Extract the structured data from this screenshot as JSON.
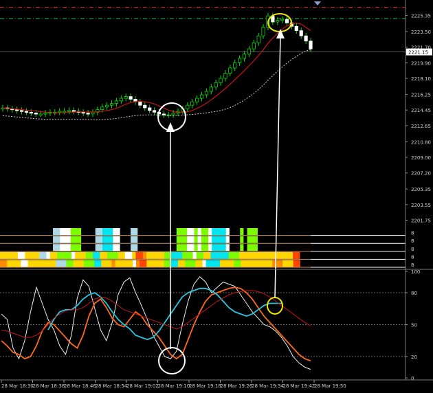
{
  "chart_data": [
    {
      "type": "candlestick",
      "title": "",
      "ylim": [
        2201.0,
        2226.5
      ],
      "y_ticks": [
        "2225.35",
        "2223.50",
        "2221.70",
        "2219.90",
        "2218.10",
        "2216.25",
        "2214.45",
        "2212.65",
        "2210.80",
        "2209.00",
        "2207.20",
        "2205.35",
        "2203.55",
        "2201.75"
      ],
      "current_price_label": "2221.15",
      "current_price": 2221.15,
      "reference_levels": [
        {
          "value": 2226.3,
          "style": "dash-dot",
          "color": "#e02020"
        },
        {
          "value": 2225.0,
          "style": "dash-dot",
          "color": "#1fbf3f"
        }
      ],
      "ma_fast_color": "#c81414",
      "ma_slow_color": "#cfcfcf",
      "candle_up_color": "#00e000",
      "candle_down_color": "#ffffff",
      "closes": [
        2214.7,
        2214.6,
        2214.5,
        2214.4,
        2214.3,
        2214.2,
        2214.1,
        2214.0,
        2214.0,
        2214.1,
        2214.2,
        2214.2,
        2214.3,
        2214.3,
        2214.4,
        2214.3,
        2214.2,
        2214.1,
        2214.0,
        2214.2,
        2214.5,
        2214.8,
        2215.0,
        2215.2,
        2215.5,
        2215.8,
        2216.0,
        2215.7,
        2215.4,
        2215.0,
        2214.7,
        2214.4,
        2214.2,
        2214.0,
        2213.9,
        2213.9,
        2214.1,
        2214.3,
        2214.6,
        2215.0,
        2215.4,
        2215.8,
        2216.2,
        2216.6,
        2217.1,
        2217.6,
        2218.1,
        2218.7,
        2219.3,
        2219.9,
        2220.4,
        2220.9,
        2221.5,
        2222.2,
        2223.0,
        2224.0,
        2225.3,
        2224.6,
        2224.8,
        2224.9,
        2224.5,
        2224.1,
        2223.6,
        2223.0,
        2222.4,
        2221.5
      ],
      "x_ticks": [
        "28 Mar 18:30",
        "28 Mar 18:38",
        "28 Mar 18:46",
        "28 Mar 18:54",
        "28 Mar 19:02",
        "28 Mar 19:10",
        "28 Mar 19:18",
        "28 Mar 19:26",
        "28 Mar 19:34",
        "28 Mar 19:42",
        "28 Mar 19:50"
      ]
    },
    {
      "type": "heatmap",
      "rows": 5,
      "row_labels": [
        "8",
        "8",
        "8",
        "8",
        "8"
      ],
      "colors": {
        "L": "#add8e6",
        "G": "#7cfc00",
        "C": "#00e5ee",
        "W": "#ffffff",
        "Y": "#ffd700",
        "O": "#ff8c00",
        "R": "#ff4500",
        "K": "#000000"
      },
      "cells": [
        "KKKKKKKKKKKKKKKLLWWWGGGKKKKLLCCCWWKKKLLKKKKKKKKKKKGGGWWGWGGWCCCCWKKKGKGGGKKKKKKKKKKKKKKK",
        "KKKKKKKKKKKKKKKLLWWWGGGKKKKLLCCCWWKKKLLKKKKKKKKKKKGGGWWGWGGWCCCCWKKKGKGGGKKKKKKKKKKKKKKK",
        "KKKKKKKKKKKKKKKLLWWWGGGKKKKLLCCCWWKKKLLKKKKKKKKKKKGGGWWGWGGWCCCCWKKKGKGGGKKKKKKKKKKKKKKK",
        "YYYYYWWYYYYLLWYYGGGGWYYYGGCCYYGGGYYWWYRROYYYYYGGCCCGGGWGGYYCCCCCGGGYYYYYYYYYYYYYYYRRKKK",
        "OOYYYYWWYYYYYYYYLLLGGYYYGGGCCYYYOYYYYYWORRYYYYYGGCCYYGGGYYWCCCCYYYYGGYYYYYYYYYOOOYYYRRKKK"
      ]
    },
    {
      "type": "line",
      "ylim": [
        0,
        100
      ],
      "y_ticks": [
        "100",
        "80",
        "50",
        "20",
        "0"
      ],
      "levels": [
        80,
        50,
        20
      ],
      "series": [
        {
          "color": "#f0f0f0",
          "values": [
            60,
            55,
            28,
            18,
            35,
            62,
            85,
            70,
            55,
            45,
            30,
            22,
            40,
            75,
            92,
            86,
            65,
            45,
            35,
            52,
            78,
            90,
            94,
            80,
            68,
            55,
            40,
            30,
            20,
            18,
            25,
            50,
            72,
            88,
            95,
            90,
            80,
            85,
            90,
            88,
            86,
            78,
            70,
            62,
            56,
            50,
            48,
            44,
            38,
            30,
            20,
            14,
            10,
            8
          ]
        },
        {
          "color": "#ff6a1a",
          "values": [
            35,
            30,
            24,
            22,
            18,
            20,
            30,
            44,
            52,
            50,
            44,
            38,
            32,
            28,
            40,
            58,
            70,
            74,
            66,
            56,
            50,
            48,
            55,
            62,
            58,
            50,
            44,
            38,
            30,
            22,
            18,
            22,
            36,
            50,
            62,
            72,
            78,
            80,
            82,
            84,
            85,
            84,
            80,
            74,
            66,
            58,
            52,
            46,
            40,
            34,
            28,
            22,
            18,
            16
          ]
        },
        {
          "color": "#27c8e0",
          "values": [
            null,
            null,
            null,
            null,
            null,
            null,
            null,
            null,
            45,
            55,
            62,
            64,
            64,
            68,
            74,
            78,
            80,
            76,
            70,
            62,
            55,
            50,
            46,
            40,
            38,
            36,
            38,
            44,
            52,
            60,
            68,
            76,
            80,
            82,
            84,
            84,
            82,
            78,
            72,
            66,
            62,
            60,
            58,
            60,
            64,
            68,
            70,
            70,
            70,
            null,
            null,
            null,
            null,
            null
          ]
        },
        {
          "color": "#c81414",
          "values": [
            45,
            44,
            42,
            40,
            38,
            38,
            40,
            44,
            50,
            56,
            60,
            63,
            64,
            64,
            66,
            70,
            74,
            76,
            75,
            72,
            68,
            64,
            62,
            60,
            58,
            56,
            54,
            52,
            50,
            48,
            46,
            48,
            52,
            56,
            60,
            64,
            68,
            72,
            75,
            78,
            80,
            81,
            82,
            82,
            81,
            79,
            76,
            72,
            68,
            64,
            60,
            56,
            52,
            49
          ]
        }
      ]
    }
  ],
  "annotations": {
    "circle_color": "#ffffff",
    "highlight_color": "#f0e600",
    "arrow_color": "#ffffff"
  }
}
